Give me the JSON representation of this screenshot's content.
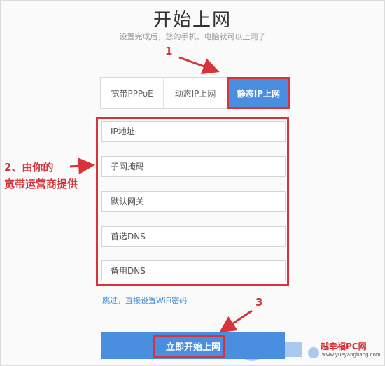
{
  "header": {
    "title": "开始上网",
    "subtitle": "设置完成后，您的手机、电脑就可以上网了"
  },
  "tabs": [
    {
      "label": "宽带PPPoE",
      "active": false
    },
    {
      "label": "动态IP上网",
      "active": false
    },
    {
      "label": "静态IP上网",
      "active": true
    }
  ],
  "form": {
    "ip_placeholder": "IP地址",
    "mask_placeholder": "子网掩码",
    "gateway_placeholder": "默认网关",
    "dns1_placeholder": "首选DNS",
    "dns2_placeholder": "备用DNS"
  },
  "skip_link": "跳过，直接设置WiFi密码",
  "submit_label": "立即开始上网",
  "annotations": {
    "step1": "1",
    "step2_line1": "2、由你的",
    "step2_line2": "宽带运营商提供",
    "step3": "3"
  },
  "watermark": {
    "brand": "越幸福PC网",
    "url": "www.yueyangbang.com"
  },
  "colors": {
    "accent": "#4a8ee0",
    "annotation_red": "#d8333a",
    "link": "#3b8bd4"
  }
}
